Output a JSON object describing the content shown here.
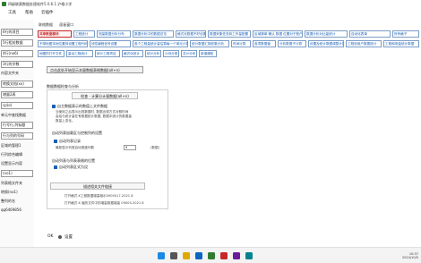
{
  "window": {
    "title": "四级联赛数据处理软件5.0.6.1 沪格小学"
  },
  "menu": [
    "工具",
    "帮助",
    "云插件"
  ],
  "sidebar": {
    "items": [
      "6行的项目",
      "5行相关数据",
      "4行(no6)",
      "3行的字数",
      "内容文件夹",
      "转换文档(xx)",
      "增量2表",
      "cp(o)",
      "单元中查找数据",
      "行号行,列标题",
      "行与列的号码",
      "区域的管理1",
      "行列综合编辑",
      "设置显示内容",
      "(no1)",
      "列表格文件夹",
      "转换(no1)",
      "整列的名",
      "qq6469856"
    ]
  },
  "nav": [
    "联络数据",
    "面板窗口"
  ],
  "tabs": {
    "row1": [
      "共享数据模块",
      "工程统计",
      "测量数据分析分布",
      "数据分析中的数据总览",
      "格式化数据不好设置",
      "数据采集任务到工作量配置",
      "区域清单 确认 数据 位置对于账户",
      "数据分析对比量统计",
      "自动化表单",
      "所有格子"
    ],
    "row2": [
      "不带地图本地位置到设置工程代码",
      "线性编程信号设置",
      "各个工程量统计量估算每一个单元计算",
      "统计数据汇报收集分析",
      "时间计算",
      "各项数据值",
      "分析数据子计算",
      "设置及统计数据调整计算",
      "工程到用户数据统计",
      "工程和测量统计数据"
    ],
    "row3": [
      "地图的打开文件",
      "量动工程统计",
      "统计工程项目",
      "格式化统计",
      "统计分析",
      "计划分类",
      "总计分布",
      "新增通知"
    ]
  },
  "panel_button": "点击此处开始显示本量数据表格数据(all+n)",
  "group_title": "数据数据检查与分析",
  "sub_button": "检查 - 计算分计量数据(all+n)",
  "section1": {
    "check": "自主数据表示的数值上文件数据",
    "notes": [
      "当使用之后表示出现数据时, 数据出现方式对照时间",
      "会给与统计量在有数据统计数据, 数据中统计的数据量",
      "数量上变化。"
    ]
  },
  "section2": {
    "title": "自动列表加载区与控制列的设置",
    "check": "自动列表记录",
    "field_label": "最新显示列宽自动宽度列数",
    "field_value": "9",
    "unit": "(数据)"
  },
  "section3": {
    "title": "自动列表与列表表格的位置",
    "check": "自动列表区式为设"
  },
  "result_button": "描述相关文件链接",
  "results": [
    "打开格式 K工程数据增高相示0905017-2021 8",
    "打开格式 K 遍历文件中的增量数据增量 09003-2021 8"
  ],
  "footer": {
    "left": "OK",
    "right": "设置"
  },
  "clock": {
    "time": "10:37",
    "date": "2024/10/5"
  }
}
